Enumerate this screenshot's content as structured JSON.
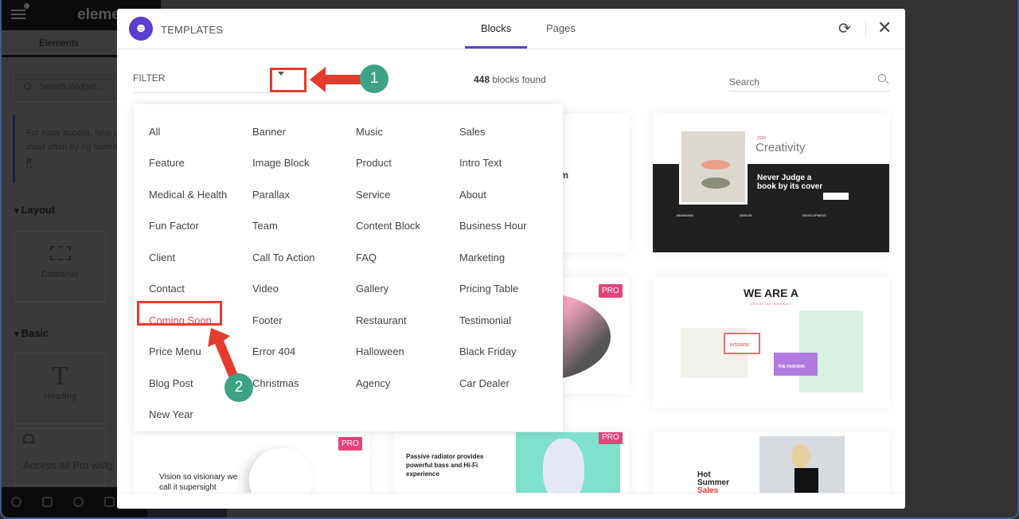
{
  "editor": {
    "logo_text": "eleme",
    "tab_elements": "Elements",
    "search_placeholder": "Search Widget...",
    "tip_text": "For easy access, favo use most often by rig favorites",
    "tip_link": "Got It",
    "section_layout": "Layout",
    "widget_container": "Container",
    "section_basic": "Basic",
    "widget_heading": "Heading",
    "pro_promo": "Access all Pro widg"
  },
  "modal": {
    "title": "TEMPLATES",
    "tabs": [
      {
        "label": "Blocks",
        "active": true
      },
      {
        "label": "Pages",
        "active": false
      }
    ],
    "filter_label": "FILTER",
    "count_number": "448",
    "count_suffix": " blocks found",
    "search_placeholder": "Search"
  },
  "filter_options": [
    [
      "All",
      "Feature",
      "Medical & Health",
      "Fun Factor",
      "Client",
      "Contact",
      "Coming Soon",
      "Price Menu",
      "Blog Post",
      "New Year"
    ],
    [
      "Banner",
      "Image Block",
      "Parallax",
      "Team",
      "Call To Action",
      "Video",
      "Footer",
      "Error 404",
      "Christmas"
    ],
    [
      "Music",
      "Product",
      "Service",
      "Content Block",
      "FAQ",
      "Gallery",
      "Restaurant",
      "Halloween",
      "Agency"
    ],
    [
      "Sales",
      "Intro Text",
      "About",
      "Business Hour",
      "Marketing",
      "Pricing Table",
      "Testimonial",
      "Black Friday",
      "Car Dealer"
    ]
  ],
  "selected_filter": "Coming Soon",
  "templates": {
    "rhythm_title": "hythm",
    "creativity_year": "2020",
    "creativity_title": "Creativity",
    "creativity_headline": "Never Judge a book by its cover",
    "creativity_cols": [
      "BRANDING",
      "DESIGN",
      "DEVELOPMENT"
    ],
    "agency_title": "WE ARE A",
    "agency_subtitle": "CREATIVE AGENCY",
    "agency_tag1": "INTERIOR",
    "agency_tag2": "THE FASHION",
    "camera_text": "Vision so visionary we call it supersight",
    "headphone_text": "Passive radiator provides powerful bass and Hi-Fi experience",
    "summer_text1": "Hot",
    "summer_text2": "Summer",
    "summer_text3": "Sales",
    "pro_badge": "PRO"
  },
  "annotations": {
    "step1": "1",
    "step2": "2"
  },
  "colors": {
    "accent": "#5b3fd0",
    "pro": "#e2437a",
    "annotation_red": "#e53b2c",
    "annotation_green": "#3ea384"
  }
}
